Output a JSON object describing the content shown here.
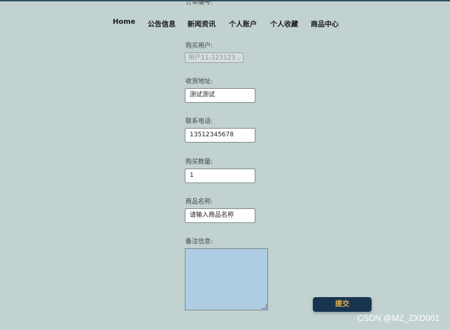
{
  "nav": {
    "items": [
      "Home",
      "公告信息",
      "新闻资讯",
      "个人账户",
      "个人收藏",
      "商品中心"
    ]
  },
  "form": {
    "cut_label": "订单编号:",
    "account_label": "购买用户:",
    "account_value": "用户11-123123",
    "address_label": "收货地址:",
    "address_value": "测试测试",
    "phone_label": "联系电话:",
    "phone_value": "13512345678",
    "quantity_label": "购买数量:",
    "quantity_value": "1",
    "product_label": "商品名称:",
    "product_value": "请输入商品名称",
    "remarks_label": "备注信息:",
    "submit_label": "提交"
  },
  "watermark": "CSDN @MZ_ZXD001",
  "colors": {
    "background": "#c2d2d1",
    "submit_bg": "#173550",
    "submit_text": "#e8b04a",
    "textarea_bg": "#aecde3"
  }
}
